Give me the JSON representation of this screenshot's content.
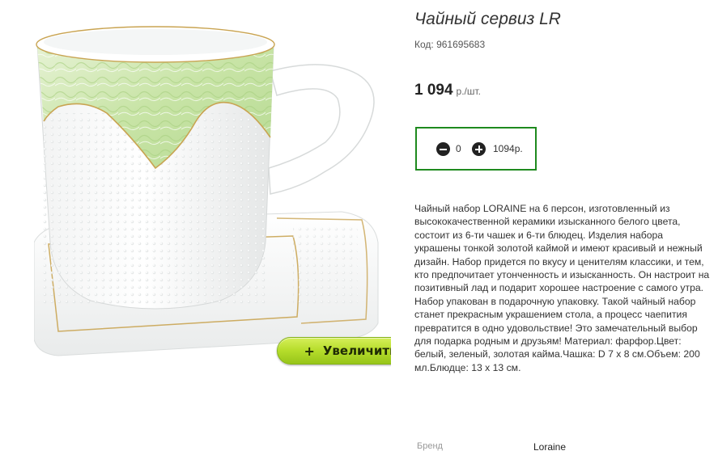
{
  "product": {
    "title": "Чайный сервиз LR",
    "code": "Код: 961695683",
    "price": "1 094",
    "price_unit": "р./шт.",
    "image_alt": "cup-and-saucer-photo",
    "zoom_button": {
      "icon": "plus",
      "label": "Увеличить"
    },
    "quantity": {
      "count": "0",
      "sum": "1094р.",
      "minus_icon": "minus-circle-icon",
      "plus_icon": "plus-circle-icon"
    },
    "description": "Чайный набор LORAINE на 6 персон, изготовленный из высококачественной керамики изысканного белого цвета, состоит из 6-ти чашек и 6-ти блюдец. Изделия набора украшены тонкой золотой каймой и имеют красивый и нежный дизайн. Набор придется по вкусу и ценителям классики, и тем, кто предпочитает утонченность и изысканность. Он настроит на позитивный лад и подарит хорошее настроение с самого утра. Набор упакован в подарочную упаковку. Такой чайный набор станет прекрасным украшением стола, а процесс чаепития превратится в одно удовольствие! Это замечательный выбор для подарка родным и друзьям! Материал: фарфор.Цвет: белый, зеленый, золотая кайма.Чашка: D 7 х 8 см.Объем: 200 мл.Блюдце: 13 х 13 см.",
    "properties": [
      {
        "label": "Бренд",
        "value": "Loraine"
      }
    ]
  },
  "colors": {
    "frame_green": "#1e8a1e",
    "button_green": "#b6dd2b",
    "cup_green": "#cfe8b0",
    "gold_trim": "#c9a452"
  }
}
